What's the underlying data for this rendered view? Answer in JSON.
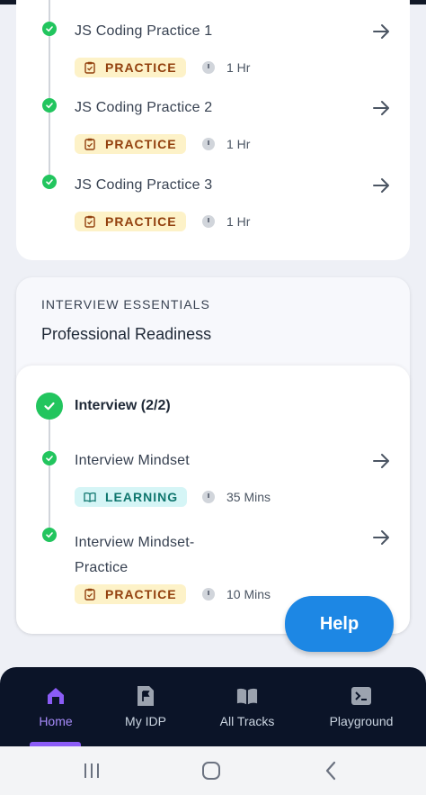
{
  "top_card": {
    "items": [
      {
        "title": "JS Coding Practice 1",
        "tag": "PRACTICE",
        "duration": "1 Hr"
      },
      {
        "title": "JS Coding Practice 2",
        "tag": "PRACTICE",
        "duration": "1 Hr"
      },
      {
        "title": "JS Coding Practice 3",
        "tag": "PRACTICE",
        "duration": "1 Hr"
      }
    ]
  },
  "interview_card": {
    "section_label": "INTERVIEW ESSENTIALS",
    "section_title": "Professional Readiness",
    "group_title": "Interview (2/2)",
    "items": [
      {
        "title": "Interview Mindset",
        "tag": "LEARNING",
        "duration": "35 Mins"
      },
      {
        "title_line1": "Interview Mindset-",
        "title_line2": "Practice",
        "tag": "PRACTICE",
        "duration": "10 Mins"
      }
    ]
  },
  "help_button": {
    "label": "Help"
  },
  "bottom_nav": {
    "items": [
      {
        "label": "Home",
        "icon": "home-icon",
        "active": true
      },
      {
        "label": "My IDP",
        "icon": "flag-document-icon"
      },
      {
        "label": "All Tracks",
        "icon": "book-icon"
      },
      {
        "label": "Playground",
        "icon": "terminal-icon"
      }
    ]
  },
  "colors": {
    "accent_purple": "#8b5cf6",
    "check_green": "#22c55e",
    "practice_bg": "#fdf2c8",
    "learning_bg": "#d5f5f6",
    "help_blue": "#1d87e4",
    "nav_bg": "#0b1428"
  }
}
